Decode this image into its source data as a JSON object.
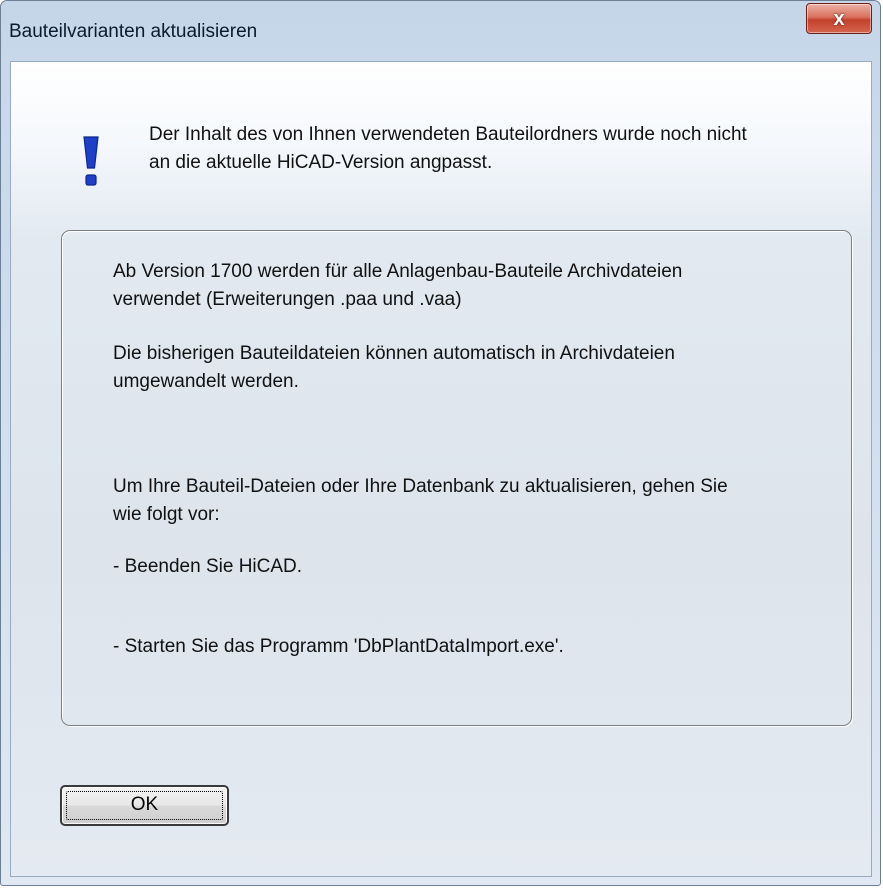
{
  "window": {
    "title": "Bauteilvarianten aktualisieren",
    "close_label": "x"
  },
  "message": {
    "icon": "exclamation-icon",
    "line1": "Der Inhalt des von Ihnen verwendeten Bauteilordners wurde noch nicht",
    "line2": "an die aktuelle HiCAD-Version angpasst."
  },
  "details": {
    "p1_line1": "Ab Version 1700 werden für alle Anlagenbau-Bauteile Archivdateien",
    "p1_line2": "verwendet (Erweiterungen .paa und .vaa)",
    "p2_line1": "Die bisherigen Bauteildateien können automatisch in Archivdateien",
    "p2_line2": "umgewandelt werden.",
    "p3_line1": "Um Ihre Bauteil-Dateien oder Ihre Datenbank zu aktualisieren, gehen Sie",
    "p3_line2": "wie folgt vor:",
    "step1": "- Beenden Sie HiCAD.",
    "step2": "- Starten Sie das Programm 'DbPlantDataImport.exe'."
  },
  "buttons": {
    "ok_label": "OK"
  },
  "colors": {
    "close_button": "#c94a36",
    "icon": "#1e3fc8"
  }
}
